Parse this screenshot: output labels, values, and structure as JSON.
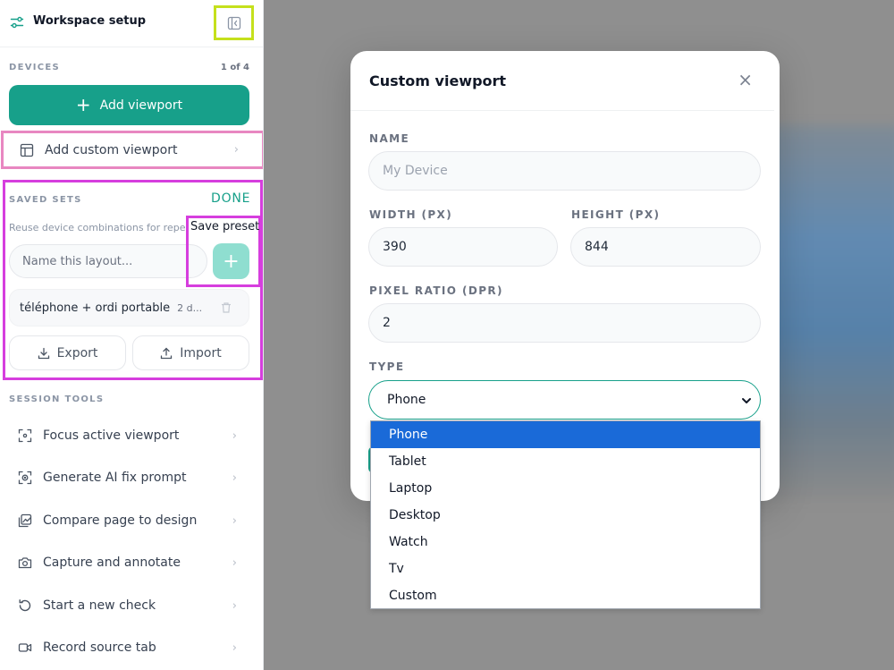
{
  "sidebar": {
    "title": "Workspace setup",
    "devices": {
      "label": "DEVICES",
      "count": "1 of 4",
      "add_viewport": "Add viewport",
      "add_custom_viewport": "Add custom viewport"
    },
    "saved_sets": {
      "label": "SAVED SETS",
      "done": "DONE",
      "description": "Reuse device combinations for repe",
      "name_placeholder": "Name this layout...",
      "save_preset_label": "Save preset",
      "presets": [
        {
          "name": "téléphone + ordi portable",
          "count": "2 d..."
        }
      ],
      "export": "Export",
      "import": "Import"
    },
    "session_tools": {
      "label": "SESSION TOOLS",
      "items": [
        {
          "label": "Focus active viewport",
          "icon": "focus-icon"
        },
        {
          "label": "Generate AI fix prompt",
          "icon": "scan-face-icon"
        },
        {
          "label": "Compare page to design",
          "icon": "image-compare-icon"
        },
        {
          "label": "Capture and annotate",
          "icon": "camera-icon"
        },
        {
          "label": "Start a new check",
          "icon": "restart-icon"
        },
        {
          "label": "Record source tab",
          "icon": "video-icon"
        }
      ]
    }
  },
  "modal": {
    "title": "Custom viewport",
    "name_label": "NAME",
    "name_placeholder": "My Device",
    "width_label": "WIDTH (PX)",
    "width_value": "390",
    "height_label": "HEIGHT (PX)",
    "height_value": "844",
    "dpr_label": "PIXEL RATIO (DPR)",
    "dpr_value": "2",
    "type_label": "TYPE",
    "type_value": "Phone",
    "type_options": [
      "Phone",
      "Tablet",
      "Laptop",
      "Desktop",
      "Watch",
      "Tv",
      "Custom"
    ]
  },
  "colors": {
    "accent": "#17a08a",
    "selected_option": "#1a6ad8",
    "highlight_lime": "#c5e01c",
    "highlight_pink": "#e887c1",
    "highlight_magenta": "#d63ede"
  }
}
